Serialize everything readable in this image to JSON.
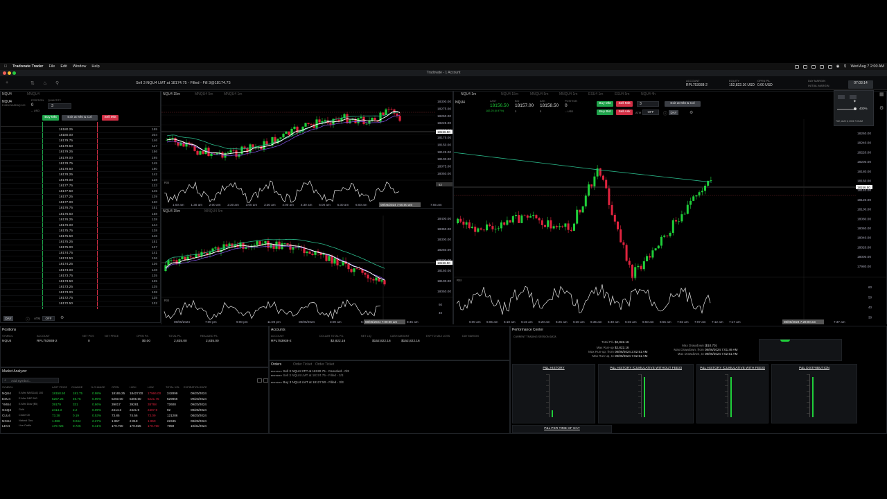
{
  "menubar": {
    "app": "Tradovate Trader",
    "items": [
      "File",
      "Edit",
      "Window",
      "Help"
    ],
    "clock": "Wed Aug 7  2:00 AM"
  },
  "window": {
    "title": "Tradovate - 1 Account"
  },
  "toolbar": {
    "fill_status": "Sell 3 NQU4 LMT at 18174.75 - Filled - Fill 3@18174.75",
    "account_label": "ACCOUNT",
    "account_value": "RPL753938-2",
    "equity_label": "EQUITY",
    "equity_value": "152,822.16 USD",
    "open_pl_label": "OPEN P/L",
    "open_pl_value": "0.00 USD",
    "day_margin_label": "DAY MARGIN",
    "initial_margin_label": "INITIAL MARGIN",
    "time_value": "07:03:14"
  },
  "dom": {
    "symbol": "NQU4",
    "tab2": "MNQU4",
    "subtitle": "E-MINI NASDAQ 100",
    "position_label": "POSITION",
    "position_value": "0",
    "quantity_label": "QUANTITY",
    "quantity_value": "3",
    "usd": "-- USD",
    "buy_mkt": "Buy Mkt",
    "exit_all": "Exit at Mkt & Cxl",
    "sell_mkt": "Sell Mkt",
    "rows": [
      {
        "p": "18180.25",
        "q": "155"
      },
      {
        "p": "18180.00",
        "q": "204"
      },
      {
        "p": "18179.75",
        "q": "146"
      },
      {
        "p": "18179.50",
        "q": "117"
      },
      {
        "p": "18179.25",
        "q": "156"
      },
      {
        "p": "18179.00",
        "q": "195"
      },
      {
        "p": "18178.75",
        "q": "145"
      },
      {
        "p": "18178.50",
        "q": "180"
      },
      {
        "p": "18178.25",
        "q": "142"
      },
      {
        "p": "18178.00",
        "q": "128"
      },
      {
        "p": "18177.75",
        "q": "123"
      },
      {
        "p": "18177.50",
        "q": "145"
      },
      {
        "p": "18177.25",
        "q": "139"
      },
      {
        "p": "18177.00",
        "q": "120"
      },
      {
        "p": "18176.75",
        "q": "151"
      },
      {
        "p": "18176.50",
        "q": "158"
      },
      {
        "p": "18176.25",
        "q": "128"
      },
      {
        "p": "18176.00",
        "q": "144"
      },
      {
        "p": "18175.75",
        "q": "138"
      },
      {
        "p": "18175.50",
        "q": "146"
      },
      {
        "p": "18175.25",
        "q": "151"
      },
      {
        "p": "18175.00",
        "q": "127"
      },
      {
        "p": "18174.75",
        "q": "141"
      },
      {
        "p": "18174.50",
        "q": "126"
      },
      {
        "p": "18174.25",
        "q": "136"
      },
      {
        "p": "18174.00",
        "q": "148"
      },
      {
        "p": "18173.75",
        "q": "135"
      },
      {
        "p": "18173.50",
        "q": "135"
      },
      {
        "p": "18173.25",
        "q": "135"
      },
      {
        "p": "18173.00",
        "q": "128"
      },
      {
        "p": "18172.75",
        "q": "135"
      },
      {
        "p": "18172.50",
        "q": "132"
      }
    ],
    "tif": "DAY",
    "atm": "ATM",
    "off": "OFF"
  },
  "chart1": {
    "tab": "NQU4 15m",
    "tab2": "MNQU4 5m",
    "tab3": "MNQU4 1m",
    "y_ticks": [
      "18300.00",
      "18275.00",
      "18250.00",
      "18225.00",
      "18200.00",
      "18175.00",
      "18150.00",
      "18125.00",
      "18100.00",
      "18075.00",
      "18050.00"
    ],
    "x_ticks": [
      "1:00 am",
      "1:30 am",
      "2:00 am",
      "2:30 am",
      "3:00 am",
      "3:30 am",
      "4:00 am",
      "4:30 am",
      "5:00 am",
      "5:30 am",
      "6:00 am",
      "7:55 am"
    ],
    "cursor_time": "08/06/2024 7:00:00 am",
    "price_tag": "18156.50",
    "rsi_label": "RSI",
    "rsi_val": "53"
  },
  "chart2": {
    "tab": "NQU4 15m",
    "tab2": "MNQU4 5m",
    "y_ticks": [
      "18400.00",
      "18350.00",
      "18300.00",
      "18250.00",
      "18200.00",
      "18150.00",
      "18100.00",
      "18050.00"
    ],
    "x_ticks": [
      "08/05/2024",
      "7:00 pm",
      "9:00 pm",
      "11:00 pm",
      "08/06/2024",
      "3:00 am",
      "5:00 am",
      "8:45 am"
    ],
    "cursor_time": "08/06/2024 7:00:00 am",
    "price_tag": "18156.50",
    "rsi_label": "RSI",
    "rsi_ticks": [
      "60",
      "40"
    ]
  },
  "chart3": {
    "tab": "NQU4 1m",
    "tab2": "NQU4 15m",
    "tab3": "MNQU4 5m",
    "tab4": "MNQU4 1m",
    "tab5": "ESU4 1m",
    "tab6": "ESU4 5m",
    "tab7": "NQU4 4h",
    "symbol": "NQU4",
    "last_label": "LAST",
    "last_value": "18156.50",
    "bid_label": "BID",
    "bid_value": "18157.00",
    "ask_label": "ASK",
    "ask_value": "18158.50",
    "position_label": "POSITION",
    "position_value": "0",
    "change": "182.25 (0.97%)",
    "bid_size": "3",
    "ask_size": "3",
    "usd": "-- USD",
    "buy_mkt": "Buy Mkt",
    "sell_mkt": "Sell Mkt",
    "buy_bid": "Buy Bid",
    "sell_ask": "Sell Ask",
    "qty": "3",
    "exit_all": "Exit at Mkt & Cxl",
    "atm": "ATM",
    "off": "OFF",
    "day": "DAY",
    "info_date": "08/06/2024 07:03",
    "info_stats": [
      "O 18156.50",
      "H 18156.50",
      "L 18143.75",
      "C 18156.50",
      "MIDDLE 18155.50",
      "SMA 18097.60",
      "VOL 70",
      "EMA 18156.91",
      "DIVERGE 30",
      "EMA 18156.88",
      "VWAP 18166.46",
      "EMA 18072.43"
    ],
    "y_ticks": [
      "18260.00",
      "18240.00",
      "18220.00",
      "18200.00",
      "18180.00",
      "18160.00",
      "18140.00",
      "18120.00",
      "18100.00",
      "18080.00",
      "18060.00",
      "18040.00",
      "18020.00",
      "18000.00",
      "17980.00"
    ],
    "x_ticks": [
      "6:00 am",
      "6:05 am",
      "6:10 am",
      "6:15 am",
      "6:20 am",
      "6:25 am",
      "6:30 am",
      "6:35 am",
      "6:40 am",
      "6:45 am",
      "6:50 am",
      "6:55 am",
      "7:02 am",
      "7:07 am",
      "7:12 am",
      "7:17 am",
      "7:37 am"
    ],
    "cursor_time": "08/06/2024 7:28:00 am",
    "price_tag": "18156.50",
    "rsi_label": "RSI",
    "rsi_ticks": [
      "60",
      "50",
      "40",
      "30"
    ],
    "zoom": "400%",
    "date_badge": "TUE, AUG 6, 2024 7:03 AM"
  },
  "positions": {
    "title": "Positions",
    "headers": [
      "SYMBOL",
      "ACCOUNT",
      "NET POS",
      "NET PRICE",
      "OPEN P/L",
      "TOTAL P/L",
      "REALIZED P/L"
    ],
    "row": [
      "NQU4",
      "RPL753938-2",
      "0",
      "",
      "$0.00",
      "2,835.00",
      "2,835.00"
    ]
  },
  "accounts": {
    "title": "Accounts",
    "headers": [
      "ACCOUNT",
      "DOLLAR TOTAL P/L",
      "NET LIQ",
      "CASH AMOUNT",
      "EXP TO MAX LOSS",
      "DAY MARGIN"
    ],
    "row": [
      "RPL753938-2",
      "$2,822.16",
      "$152,822.16",
      "$152,822.16",
      "",
      ""
    ]
  },
  "orders": {
    "tabs": [
      "Orders",
      "Order Ticket",
      "Order Ticket"
    ],
    "rows": [
      "Sell 3 NQU4 STP at 18130.75 - Canceled - 0/3",
      "Sell 3 NQU4 LMT at 18174.75 - Filled - 3/3",
      "Buy 3 NQU4 LMT at 18127.50 - Filled - 3/3"
    ]
  },
  "market_analyzer": {
    "title": "Market Analyzer",
    "search_placeholder": "Add Symbol...",
    "headers": [
      "SYMBOL",
      "LAST PRICE",
      "CHANGE",
      "% CHANGE",
      "OPEN",
      "HIGH",
      "LOW",
      "TOTAL VOL",
      "EXPIRATION DATE"
    ],
    "rows": [
      {
        "s": "NQU4",
        "d": "E-Mini NASDAQ 100",
        "last": "18158.50",
        "chg": "181.75",
        "pct": "0.98%",
        "open": "18165.25",
        "high": "18427.00",
        "low": "17966.00",
        "vol": "242899",
        "exp": "09/20/2024"
      },
      {
        "s": "ESU4",
        "d": "E-Mini S&P 500",
        "last": "5267.25",
        "chg": "49.75",
        "pct": "0.96%",
        "open": "5250.00",
        "high": "5305.50",
        "low": "5221.75",
        "vol": "629856",
        "exp": "09/20/2024"
      },
      {
        "s": "YMU4",
        "d": "E-Mini Dow ($5)",
        "last": "39179",
        "chg": "331",
        "pct": "0.86%",
        "open": "39017",
        "high": "39281",
        "low": "38768",
        "vol": "72608",
        "exp": "09/20/2024"
      },
      {
        "s": "GCQ4",
        "d": "Gold",
        "last": "2414.3",
        "chg": "2.2",
        "pct": "0.09%",
        "open": "2414.3",
        "high": "2421.9",
        "low": "2407.9",
        "vol": "92",
        "exp": "08/28/2024"
      },
      {
        "s": "CLU4",
        "d": "Crude Oil",
        "last": "73.38",
        "chg": "0.19",
        "pct": "0.53%",
        "open": "73.85",
        "high": "74.56",
        "low": "73.09",
        "vol": "121286",
        "exp": "08/20/2024"
      },
      {
        "s": "NGU4",
        "d": "Natural Gas",
        "last": "1.986",
        "chg": "0.044",
        "pct": "2.27%",
        "open": "1.957",
        "high": "2.018",
        "low": "1.950",
        "vol": "22345",
        "exp": "08/28/2024"
      },
      {
        "s": "LEV4",
        "d": "Live Cattle",
        "last": "179.725",
        "chg": "0.725",
        "pct": "0.41%",
        "open": "179.700",
        "high": "179.925",
        "low": "178.750",
        "vol": "7959",
        "exp": "10/31/2024"
      }
    ]
  },
  "performance": {
    "title": "Performance Center",
    "session": "CURRENT TRADING SESSION DATA",
    "total_pl_label": "Total P/L",
    "total_pl": "$2,822.16",
    "max_runup_label": "Max Run-up",
    "max_runup": "$2,822.16",
    "max_runup_from_label": "Max Run-up, from",
    "max_runup_from": "08/06/2024 2:02:51 AM",
    "max_runup_to_label": "Max Run-up, to",
    "max_runup_to": "08/06/2024 7:02:51 AM",
    "max_dd_label": "Max Drawdown",
    "max_dd": "($10.70)",
    "max_dd_from_label": "Max Drawdown, from",
    "max_dd_from": "08/06/2024 7:01:49 AM",
    "max_dd_to_label": "Max Drawdown, to",
    "max_dd_to": "08/06/2024 7:02:51 AM",
    "cards": [
      "P&L HISTORY",
      "P&L HISTORY (CUMULATIVE WITHOUT FEES)",
      "P&L HISTORY (CUMULATIVE WITH FEES)",
      "P&L DISTRIBUTION"
    ],
    "per_time": "P&L PER TIME OF DAY"
  },
  "colors": {
    "up": "#1fcf3a",
    "down": "#e0233e",
    "ema1": "#ffffff",
    "ema2": "#7a4dd8",
    "ema3": "#2ab98a",
    "bg": "#000000"
  }
}
